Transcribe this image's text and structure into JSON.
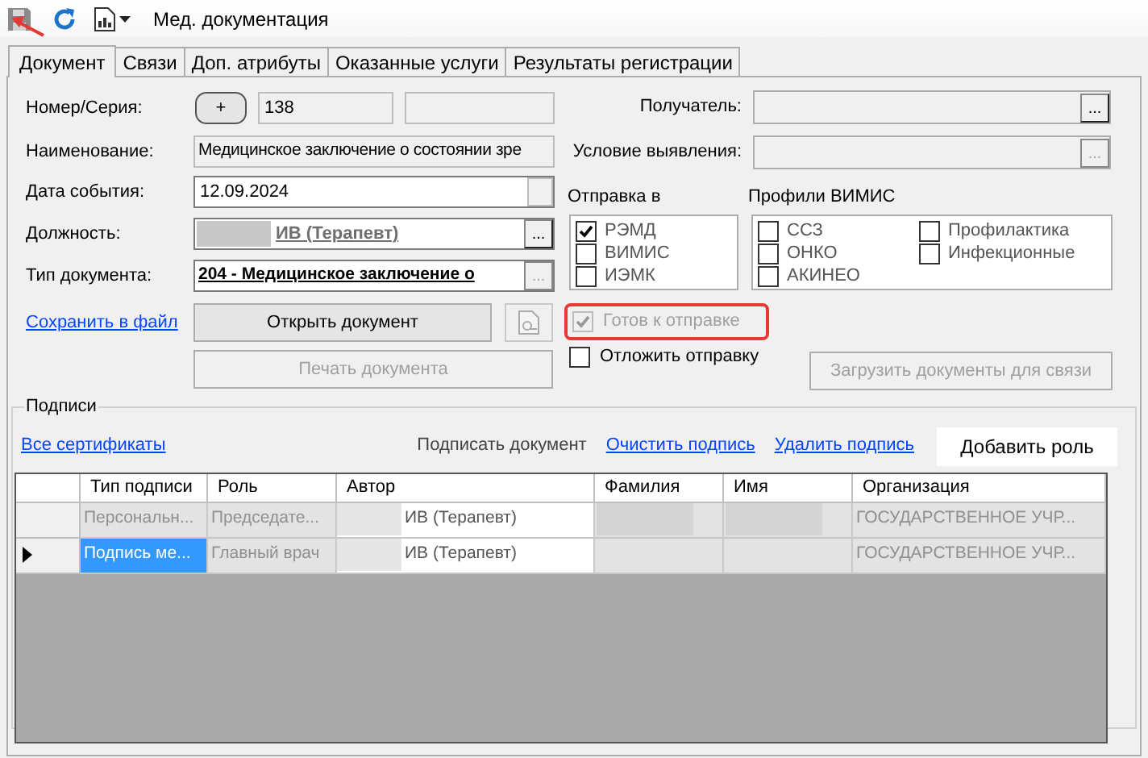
{
  "toolbar": {
    "title": "Мед. документация",
    "save_arrow": true
  },
  "tabs": [
    {
      "label": "Документ",
      "selected": true
    },
    {
      "label": "Связи",
      "selected": false
    },
    {
      "label": "Доп. атрибуты",
      "selected": false
    },
    {
      "label": "Оказанные услуги",
      "selected": false
    },
    {
      "label": "Результаты регистрации",
      "selected": false
    }
  ],
  "number": {
    "label": "Номер/Серия:",
    "button": "+",
    "value": "138"
  },
  "name": {
    "label": "Наименование:",
    "value": "Медицинское заключение о состоянии зре",
    "readonly": true
  },
  "event_date": {
    "label": "Дата события:",
    "value": "12.09.2024"
  },
  "position": {
    "label": "Должность:",
    "value": "ИВ (Терапевт)",
    "redacted_prefix": true,
    "browse": "..."
  },
  "doc_type": {
    "label": "Тип документа:",
    "value": "204 - Медицинское заключение о",
    "browse": "..."
  },
  "recipient": {
    "label": "Получатель:",
    "browse": "...",
    "disabled": false
  },
  "condition": {
    "label": "Условие выявления:",
    "browse": "...",
    "disabled": true
  },
  "send_to": {
    "label": "Отправка в",
    "items": [
      {
        "label": "РЭМД",
        "checked": true
      },
      {
        "label": "ВИМИС",
        "checked": false
      },
      {
        "label": "ИЭМК",
        "checked": false
      }
    ]
  },
  "vimis_profiles": {
    "label": "Профили ВИМИС",
    "items": [
      {
        "label": "ССЗ",
        "checked": false
      },
      {
        "label": "ОНКО",
        "checked": false
      },
      {
        "label": "АКИНЕО",
        "checked": false
      },
      {
        "label": "Профилактика",
        "checked": false
      },
      {
        "label": "Инфекционные",
        "checked": false
      }
    ]
  },
  "save_link": "Сохранить в файл",
  "open_button": {
    "label": "Открыть документ",
    "disabled": false
  },
  "print_button": {
    "label": "Печать документа",
    "disabled": true
  },
  "upload_button": {
    "label": "Загрузить документы для связи",
    "disabled": true
  },
  "ready": {
    "label": "Готов к отправке",
    "checked": true,
    "disabled": true,
    "highlighted": true
  },
  "postpone": {
    "label": "Отложить отправку",
    "checked": false,
    "disabled": false
  },
  "signatures": {
    "title": "Подписи",
    "actions": [
      {
        "kind": "link",
        "label": "Все сертификаты"
      },
      {
        "kind": "text",
        "label": "Подписать документ"
      },
      {
        "kind": "link",
        "label": "Очистить подпись"
      },
      {
        "kind": "link",
        "label": "Удалить подпись"
      },
      {
        "kind": "button",
        "label": "Добавить роль"
      }
    ],
    "columns": [
      "Тип подписи",
      "Роль",
      "Автор",
      "Фамилия",
      "Имя",
      "Организация"
    ],
    "rows": [
      {
        "current": false,
        "cells": [
          {
            "text": "Персональн...",
            "readonly": true,
            "selected": false
          },
          {
            "text": "Председате...",
            "readonly": true,
            "selected": false
          },
          {
            "text": "ИВ (Терапевт)",
            "redacted_prefix": true,
            "selected": false
          },
          {
            "redacted": true,
            "selected": false
          },
          {
            "redacted": true,
            "selected": false
          },
          {
            "text": "ГОСУДАРСТВЕННОЕ УЧР...",
            "readonly": true,
            "selected": false
          }
        ]
      },
      {
        "current": true,
        "cells": [
          {
            "text": "Подпись ме...",
            "selected": true
          },
          {
            "text": "Главный врач",
            "readonly": true,
            "selected": false
          },
          {
            "text": "ИВ (Терапевт)",
            "redacted_prefix": true,
            "selected": false
          },
          {
            "readonly": true,
            "selected": false
          },
          {
            "readonly": true,
            "selected": false
          },
          {
            "text": "ГОСУДАРСТВЕННОЕ УЧР...",
            "readonly": true,
            "selected": false
          }
        ]
      }
    ]
  }
}
